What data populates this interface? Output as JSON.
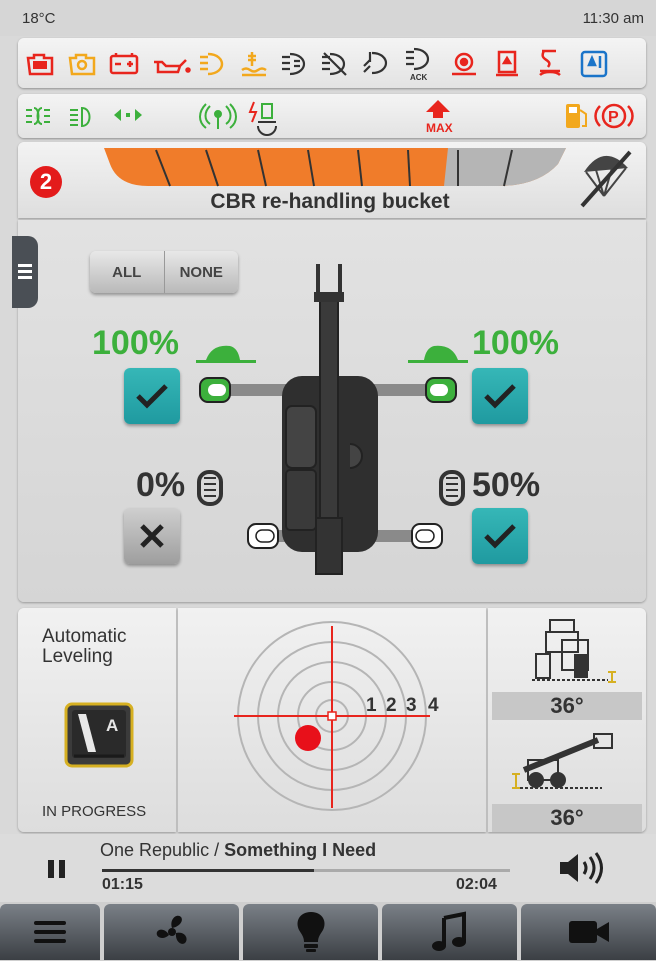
{
  "status": {
    "temperature": "18°C",
    "time": "11:30 am"
  },
  "warnings_row1": [
    {
      "icon": "engine-stop-icon",
      "color": "#e8251d"
    },
    {
      "icon": "engine-check-icon",
      "color": "#f2a81d"
    },
    {
      "icon": "battery-icon",
      "color": "#e8251d"
    },
    {
      "icon": "oil-pressure-icon",
      "color": "#e8251d"
    },
    {
      "icon": "hydraulic-filter-icon",
      "color": "#f2a81d"
    },
    {
      "icon": "coolant-temperature-icon",
      "color": "#f2a81d"
    },
    {
      "icon": "transmission-icon",
      "color": "#333333"
    },
    {
      "icon": "transmission-fault-icon",
      "color": "#333333"
    },
    {
      "icon": "transmission-temperature-icon",
      "color": "#333333"
    },
    {
      "icon": "transmission-ack-icon",
      "color": "#333333",
      "label": "ACK"
    },
    {
      "icon": "axle-oil-icon",
      "color": "#e8251d"
    },
    {
      "icon": "fuel-filter-icon",
      "color": "#e8251d"
    },
    {
      "icon": "air-filter-icon",
      "color": "#e8251d"
    },
    {
      "icon": "hydraulic-temperature-icon",
      "color": "#1a74c9"
    }
  ],
  "warnings_row2": {
    "fog_lights": {
      "icon": "fog-lights-icon",
      "color": "#3cb03c"
    },
    "low_beam": {
      "icon": "low-beam-icon",
      "color": "#3cb03c"
    },
    "turn_signals": {
      "icon": "turn-signals-icon",
      "color": "#3cb03c"
    },
    "radio": {
      "icon": "radio-signal-icon",
      "color": "#3cb03c"
    },
    "boom": {
      "icon": "boom-suspension-icon",
      "color": "#3cb03c"
    },
    "max_load": {
      "icon": "max-load-icon",
      "color": "#e8251d",
      "label": "MAX"
    },
    "fuel": {
      "icon": "fuel-level-icon",
      "color": "#f2a81d"
    },
    "parking_brake": {
      "icon": "parking-brake-icon",
      "color": "#e8251d",
      "label": "(P)"
    }
  },
  "tool": {
    "number": "2",
    "name": "CBR re-handling bucket",
    "segments_total": 9,
    "segments_active": 6
  },
  "stabilizers": {
    "all_label": "ALL",
    "none_label": "NONE",
    "front_left": {
      "percent": "100%",
      "checked": true
    },
    "front_right": {
      "percent": "100%",
      "checked": true
    },
    "rear_left": {
      "percent": "0%",
      "checked": false
    },
    "rear_right": {
      "percent": "50%",
      "checked": true
    }
  },
  "leveling": {
    "title": "Automatic Leveling",
    "mode_label": "A",
    "status": "IN PROGRESS",
    "rings": [
      "1",
      "2",
      "3",
      "4"
    ],
    "lateral_angle": "36°",
    "longitudinal_angle": "36°"
  },
  "media": {
    "artist": "One Republic",
    "separator": " / ",
    "track": "Something I Need",
    "elapsed": "01:15",
    "total": "02:04",
    "progress": 0.52
  },
  "nav": [
    "menu-icon",
    "fan-icon",
    "lightbulb-icon",
    "music-icon",
    "camera-icon"
  ]
}
